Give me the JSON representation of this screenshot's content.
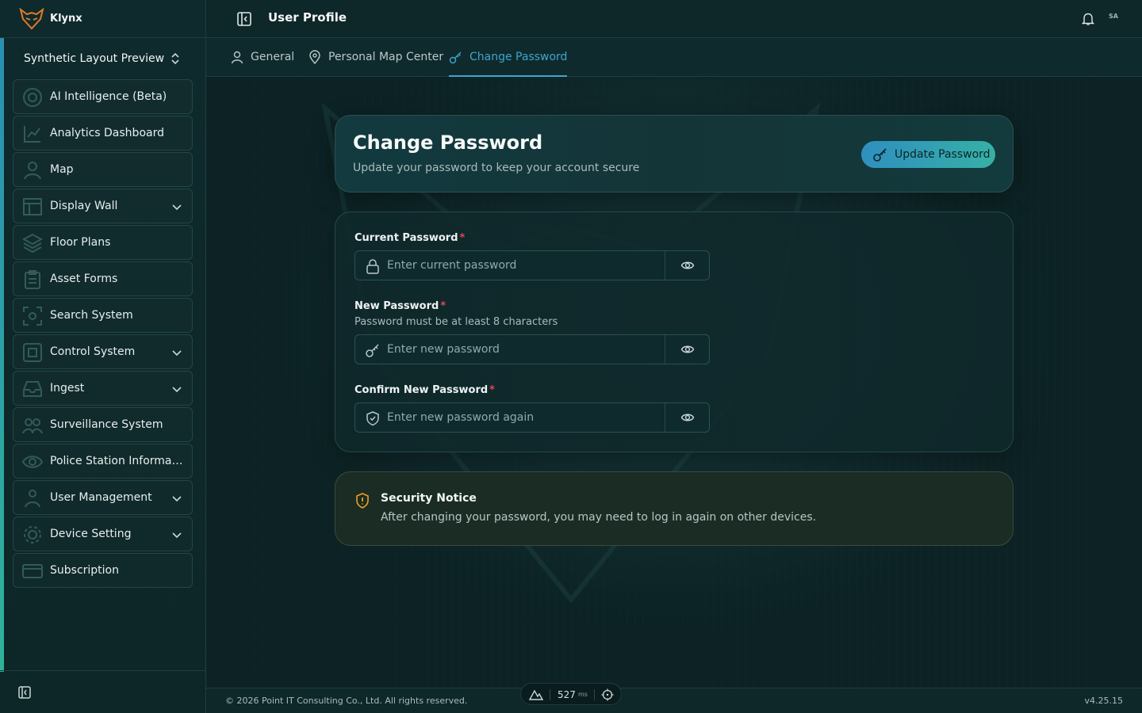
{
  "app": {
    "brand_name": "Klynx",
    "workspace": "Synthetic Layout Preview"
  },
  "sidebar": {
    "items": [
      {
        "label": "AI Intelligence (Beta)",
        "icon": "ai-icon",
        "has_children": false
      },
      {
        "label": "Analytics Dashboard",
        "icon": "analytics-icon",
        "has_children": false
      },
      {
        "label": "Map",
        "icon": "user-pin-icon",
        "has_children": false
      },
      {
        "label": "Display Wall",
        "icon": "display-wall-icon",
        "has_children": true
      },
      {
        "label": "Floor Plans",
        "icon": "layers-icon",
        "has_children": false
      },
      {
        "label": "Asset Forms",
        "icon": "clipboard-icon",
        "has_children": false
      },
      {
        "label": "Search System",
        "icon": "scan-icon",
        "has_children": false
      },
      {
        "label": "Control System",
        "icon": "control-icon",
        "has_children": true
      },
      {
        "label": "Ingest",
        "icon": "inbox-icon",
        "has_children": true
      },
      {
        "label": "Surveillance System",
        "icon": "surveillance-icon",
        "has_children": false
      },
      {
        "label": "Police Station Informati...",
        "icon": "eye-icon",
        "has_children": false
      },
      {
        "label": "User Management",
        "icon": "users-icon",
        "has_children": true
      },
      {
        "label": "Device Setting",
        "icon": "gear-icon",
        "has_children": true
      },
      {
        "label": "Subscription",
        "icon": "card-icon",
        "has_children": false
      }
    ]
  },
  "header": {
    "title": "User Profile",
    "avatar_initials": "SA"
  },
  "tabs": [
    {
      "label": "General",
      "icon": "user-icon",
      "active": false
    },
    {
      "label": "Personal Map Center",
      "icon": "map-pin-icon",
      "active": false
    },
    {
      "label": "Change Password",
      "icon": "key-icon",
      "active": true
    }
  ],
  "page": {
    "title": "Change Password",
    "subtitle": "Update your password to keep your account secure",
    "update_button": "Update Password"
  },
  "form": {
    "current": {
      "label": "Current Password",
      "required_mark": "*",
      "placeholder": "Enter current password"
    },
    "new": {
      "label": "New Password",
      "required_mark": "*",
      "help": "Password must be at least 8 characters",
      "placeholder": "Enter new password"
    },
    "confirm": {
      "label": "Confirm New Password",
      "required_mark": "*",
      "placeholder": "Enter new password again"
    }
  },
  "notice": {
    "title": "Security Notice",
    "text": "After changing your password, you may need to log in again on other devices."
  },
  "footer": {
    "copyright": "© 2026 Point IT Consulting Co., Ltd. All rights reserved.",
    "version": "v4.25.15"
  },
  "perf": {
    "value": "527",
    "unit": "ms"
  },
  "colors": {
    "accent": "#3fa5d0",
    "required": "#e0455a",
    "warning": "#f0a020"
  }
}
